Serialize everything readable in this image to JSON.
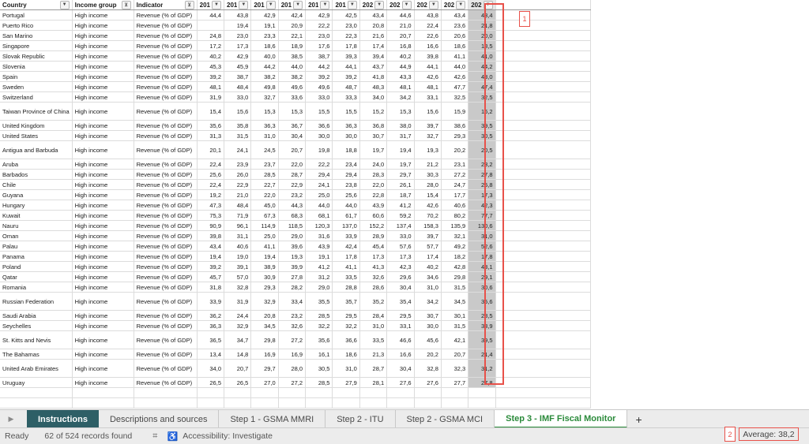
{
  "headers": {
    "country": "Country",
    "income": "Income group",
    "indicator": "Indicator",
    "years": [
      "201",
      "201",
      "201",
      "201",
      "201",
      "201",
      "202",
      "202",
      "202",
      "202",
      "202"
    ]
  },
  "rows": [
    {
      "country": "Portugal",
      "income": "High income",
      "indicator": "Revenue (% of GDP)",
      "values": [
        "44,4",
        "43,8",
        "42,9",
        "42,4",
        "42,9",
        "42,5",
        "43,4",
        "44,6",
        "43,8",
        "43,4",
        "43,4"
      ],
      "tall": false
    },
    {
      "country": "Puerto Rico",
      "income": "High income",
      "indicator": "Revenue (% of GDP)",
      "values": [
        "",
        "19,4",
        "19,1",
        "20,9",
        "22,2",
        "23,0",
        "20,8",
        "21,0",
        "22,4",
        "23,6",
        "21,8"
      ],
      "tall": false
    },
    {
      "country": "San Marino",
      "income": "High income",
      "indicator": "Revenue (% of GDP)",
      "values": [
        "24,8",
        "23,0",
        "23,3",
        "22,1",
        "23,0",
        "22,3",
        "21,6",
        "20,7",
        "22,6",
        "20,6",
        "20,0"
      ],
      "tall": false
    },
    {
      "country": "Singapore",
      "income": "High income",
      "indicator": "Revenue (% of GDP)",
      "values": [
        "17,2",
        "17,3",
        "18,6",
        "18,9",
        "17,6",
        "17,8",
        "17,4",
        "16,8",
        "16,6",
        "18,6",
        "18,5"
      ],
      "tall": false
    },
    {
      "country": "Slovak Republic",
      "income": "High income",
      "indicator": "Revenue (% of GDP)",
      "values": [
        "40,2",
        "42,9",
        "40,0",
        "38,5",
        "38,7",
        "39,3",
        "39,4",
        "40,2",
        "39,8",
        "41,1",
        "41,0"
      ],
      "tall": false
    },
    {
      "country": "Slovenia",
      "income": "High income",
      "indicator": "Revenue (% of GDP)",
      "values": [
        "45,3",
        "45,9",
        "44,2",
        "44,0",
        "44,2",
        "44,1",
        "43,7",
        "44,9",
        "44,1",
        "44,0",
        "44,2"
      ],
      "tall": false
    },
    {
      "country": "Spain",
      "income": "High income",
      "indicator": "Revenue (% of GDP)",
      "values": [
        "39,2",
        "38,7",
        "38,2",
        "38,2",
        "39,2",
        "39,2",
        "41,8",
        "43,3",
        "42,6",
        "42,6",
        "43,0"
      ],
      "tall": false
    },
    {
      "country": "Sweden",
      "income": "High income",
      "indicator": "Revenue (% of GDP)",
      "values": [
        "48,1",
        "48,4",
        "49,8",
        "49,6",
        "49,6",
        "48,7",
        "48,3",
        "48,1",
        "48,1",
        "47,7",
        "47,4"
      ],
      "tall": false
    },
    {
      "country": "Switzerland",
      "income": "High income",
      "indicator": "Revenue (% of GDP)",
      "values": [
        "31,9",
        "33,0",
        "32,7",
        "33,6",
        "33,0",
        "33,3",
        "34,0",
        "34,2",
        "33,1",
        "32,5",
        "32,5"
      ],
      "tall": false
    },
    {
      "country": "Taiwan Province of China",
      "income": "High income",
      "indicator": "Revenue (% of GDP)",
      "values": [
        "15,4",
        "15,6",
        "15,3",
        "15,3",
        "15,5",
        "15,5",
        "15,2",
        "15,3",
        "15,6",
        "15,9",
        "16,2"
      ],
      "tall": true
    },
    {
      "country": "United Kingdom",
      "income": "High income",
      "indicator": "Revenue (% of GDP)",
      "values": [
        "35,6",
        "35,8",
        "36,3",
        "36,7",
        "36,6",
        "36,3",
        "36,8",
        "38,0",
        "39,7",
        "38,6",
        "39,5"
      ],
      "tall": false
    },
    {
      "country": "United States",
      "income": "High income",
      "indicator": "Revenue (% of GDP)",
      "values": [
        "31,3",
        "31,5",
        "31,0",
        "30,4",
        "30,0",
        "30,0",
        "30,7",
        "31,7",
        "32,7",
        "29,3",
        "30,5"
      ],
      "tall": false
    },
    {
      "country": "Antigua and Barbuda",
      "income": "High income",
      "indicator": "Revenue (% of GDP)",
      "values": [
        "20,1",
        "24,1",
        "24,5",
        "20,7",
        "19,8",
        "18,8",
        "19,7",
        "19,4",
        "19,3",
        "20,2",
        "20,5"
      ],
      "tall": true
    },
    {
      "country": "Aruba",
      "income": "High income",
      "indicator": "Revenue (% of GDP)",
      "values": [
        "22,4",
        "23,9",
        "23,7",
        "22,0",
        "22,2",
        "23,4",
        "24,0",
        "19,7",
        "21,2",
        "23,1",
        "23,2"
      ],
      "tall": false
    },
    {
      "country": "Barbados",
      "income": "High income",
      "indicator": "Revenue (% of GDP)",
      "values": [
        "25,6",
        "26,0",
        "28,5",
        "28,7",
        "29,4",
        "29,4",
        "28,3",
        "29,7",
        "30,3",
        "27,2",
        "27,8"
      ],
      "tall": false
    },
    {
      "country": "Chile",
      "income": "High income",
      "indicator": "Revenue (% of GDP)",
      "values": [
        "22,4",
        "22,9",
        "22,7",
        "22,9",
        "24,1",
        "23,8",
        "22,0",
        "26,1",
        "28,0",
        "24,7",
        "25,8"
      ],
      "tall": false
    },
    {
      "country": "Guyana",
      "income": "High income",
      "indicator": "Revenue (% of GDP)",
      "values": [
        "19,2",
        "21,0",
        "22,0",
        "23,2",
        "25,0",
        "25,6",
        "22,8",
        "18,7",
        "15,4",
        "17,7",
        "17,3"
      ],
      "tall": false
    },
    {
      "country": "Hungary",
      "income": "High income",
      "indicator": "Revenue (% of GDP)",
      "values": [
        "47,3",
        "48,4",
        "45,0",
        "44,3",
        "44,0",
        "44,0",
        "43,9",
        "41,2",
        "42,6",
        "40,6",
        "42,3"
      ],
      "tall": false
    },
    {
      "country": "Kuwait",
      "income": "High income",
      "indicator": "Revenue (% of GDP)",
      "values": [
        "75,3",
        "71,9",
        "67,3",
        "68,3",
        "68,1",
        "61,7",
        "60,6",
        "59,2",
        "70,2",
        "80,2",
        "77,7"
      ],
      "tall": false
    },
    {
      "country": "Nauru",
      "income": "High income",
      "indicator": "Revenue (% of GDP)",
      "values": [
        "90,9",
        "96,1",
        "114,9",
        "118,5",
        "120,3",
        "137,0",
        "152,2",
        "137,4",
        "158,3",
        "135,9",
        "130,6"
      ],
      "tall": false
    },
    {
      "country": "Oman",
      "income": "High income",
      "indicator": "Revenue (% of GDP)",
      "values": [
        "39,8",
        "31,1",
        "25,0",
        "29,0",
        "31,6",
        "33,9",
        "28,9",
        "33,0",
        "39,7",
        "32,1",
        "31,0"
      ],
      "tall": false
    },
    {
      "country": "Palau",
      "income": "High income",
      "indicator": "Revenue (% of GDP)",
      "values": [
        "43,4",
        "40,6",
        "41,1",
        "39,6",
        "43,9",
        "42,4",
        "45,4",
        "57,6",
        "57,7",
        "49,2",
        "52,6"
      ],
      "tall": false
    },
    {
      "country": "Panama",
      "income": "High income",
      "indicator": "Revenue (% of GDP)",
      "values": [
        "19,4",
        "19,0",
        "19,4",
        "19,3",
        "19,1",
        "17,8",
        "17,3",
        "17,3",
        "17,4",
        "18,2",
        "17,8"
      ],
      "tall": false
    },
    {
      "country": "Poland",
      "income": "High income",
      "indicator": "Revenue (% of GDP)",
      "values": [
        "39,2",
        "39,1",
        "38,9",
        "39,9",
        "41,2",
        "41,1",
        "41,3",
        "42,3",
        "40,2",
        "42,8",
        "43,1"
      ],
      "tall": false
    },
    {
      "country": "Qatar",
      "income": "High income",
      "indicator": "Revenue (% of GDP)",
      "values": [
        "45,7",
        "57,0",
        "30,9",
        "27,8",
        "31,2",
        "33,5",
        "32,6",
        "29,6",
        "34,6",
        "29,8",
        "29,1"
      ],
      "tall": false
    },
    {
      "country": "Romania",
      "income": "High income",
      "indicator": "Revenue (% of GDP)",
      "values": [
        "31,8",
        "32,8",
        "29,3",
        "28,2",
        "29,0",
        "28,8",
        "28,6",
        "30,4",
        "31,0",
        "31,5",
        "30,6"
      ],
      "tall": false
    },
    {
      "country": "Russian Federation",
      "income": "High income",
      "indicator": "Revenue (% of GDP)",
      "values": [
        "33,9",
        "31,9",
        "32,9",
        "33,4",
        "35,5",
        "35,7",
        "35,2",
        "35,4",
        "34,2",
        "34,5",
        "35,6"
      ],
      "tall": true
    },
    {
      "country": "Saudi Arabia",
      "income": "High income",
      "indicator": "Revenue (% of GDP)",
      "values": [
        "36,2",
        "24,4",
        "20,8",
        "23,2",
        "28,5",
        "29,5",
        "28,4",
        "29,5",
        "30,7",
        "30,1",
        "28,5"
      ],
      "tall": false
    },
    {
      "country": "Seychelles",
      "income": "High income",
      "indicator": "Revenue (% of GDP)",
      "values": [
        "36,3",
        "32,9",
        "34,5",
        "32,6",
        "32,2",
        "32,2",
        "31,0",
        "33,1",
        "30,0",
        "31,5",
        "33,9"
      ],
      "tall": false
    },
    {
      "country": "St. Kitts and Nevis",
      "income": "High income",
      "indicator": "Revenue (% of GDP)",
      "values": [
        "36,5",
        "34,7",
        "29,8",
        "27,2",
        "35,6",
        "36,6",
        "33,5",
        "46,6",
        "45,6",
        "42,1",
        "39,5"
      ],
      "tall": true
    },
    {
      "country": "The Bahamas",
      "income": "High income",
      "indicator": "Revenue (% of GDP)",
      "values": [
        "13,4",
        "14,8",
        "16,9",
        "16,9",
        "16,1",
        "18,6",
        "21,3",
        "16,6",
        "20,2",
        "20,7",
        "21,4"
      ],
      "tall": false
    },
    {
      "country": "United Arab Emirates",
      "income": "High income",
      "indicator": "Revenue (% of GDP)",
      "values": [
        "34,0",
        "20,7",
        "29,7",
        "28,0",
        "30,5",
        "31,0",
        "28,7",
        "30,4",
        "32,8",
        "32,3",
        "31,2"
      ],
      "tall": true
    },
    {
      "country": "Uruguay",
      "income": "High income",
      "indicator": "Revenue (% of GDP)",
      "values": [
        "26,5",
        "26,5",
        "27,0",
        "27,2",
        "28,5",
        "27,9",
        "28,1",
        "27,6",
        "27,6",
        "27,7",
        "27,8"
      ],
      "tall": false
    }
  ],
  "empty_rows": 3,
  "callouts": {
    "one": "1",
    "two": "2"
  },
  "tabs": [
    {
      "label": "Instructions",
      "style": "dark"
    },
    {
      "label": "Descriptions and sources",
      "style": "normal"
    },
    {
      "label": "Step 1 - GSMA MMRI",
      "style": "normal"
    },
    {
      "label": "Step 2 - ITU",
      "style": "normal"
    },
    {
      "label": "Step 2 - GSMA MCI",
      "style": "normal"
    },
    {
      "label": "Step 3 - IMF Fiscal Monitor",
      "style": "active"
    }
  ],
  "tab_add_label": "+",
  "status": {
    "ready": "Ready",
    "records": "62 of 524 records found",
    "accessibility": "Accessibility: Investigate",
    "average": "Average: 38,2"
  },
  "colors": {
    "selection_outline": "#e8514a",
    "active_tab_text": "#2a8a3a",
    "instructions_tab_bg": "#2e5f66"
  }
}
